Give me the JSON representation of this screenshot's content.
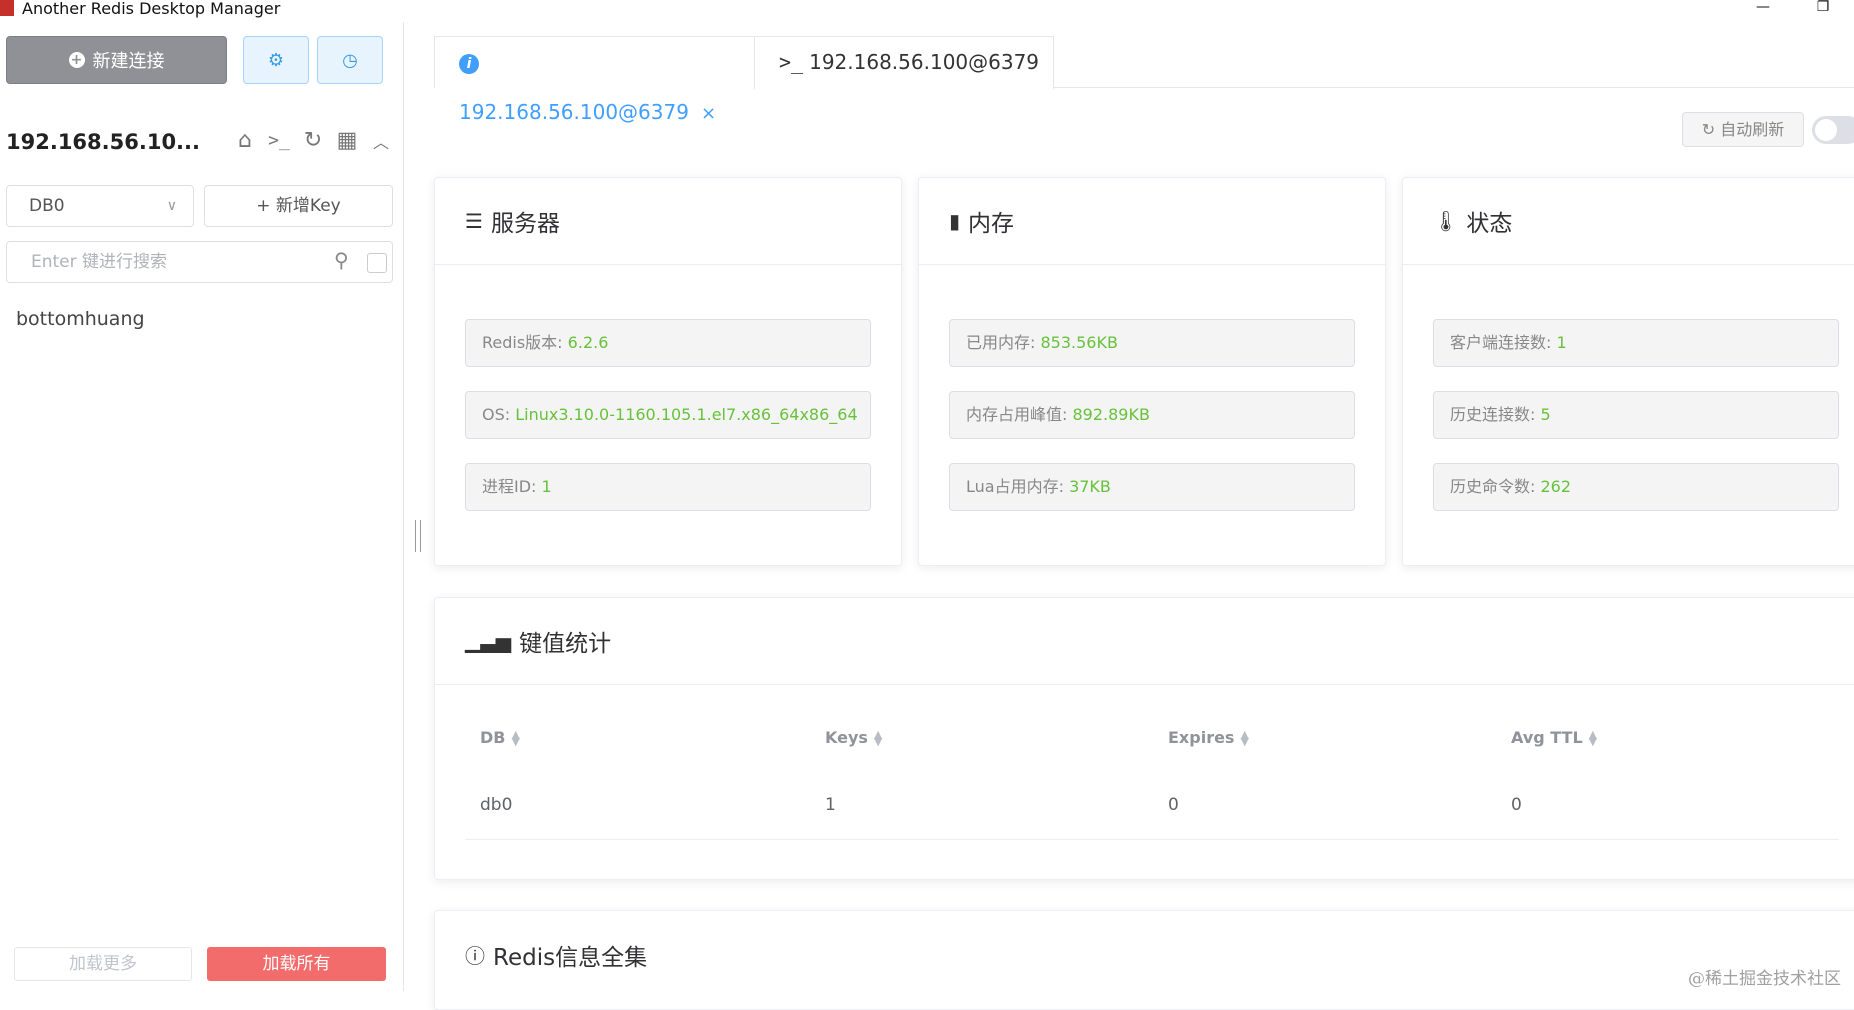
{
  "window": {
    "title": "Another Redis Desktop Manager",
    "minimize_glyph": "—",
    "restore_glyph": "❐"
  },
  "sidebar": {
    "new_connection_label": "新建连接",
    "connection_name": "192.168.56.10...",
    "db_selected": "DB0",
    "new_key_label": "+ 新增Key",
    "search_placeholder": "Enter 键进行搜索",
    "keys": [
      "bottomhuang"
    ],
    "load_more_label": "加载更多",
    "load_all_label": "加载所有"
  },
  "tabs": [
    {
      "label": "192.168.56.100@6379",
      "icon": "info-icon",
      "closable": true,
      "active": true
    },
    {
      "label": "192.168.56.100@6379",
      "icon": "terminal-icon",
      "prefix": ">_",
      "active": false
    }
  ],
  "toolbar": {
    "auto_refresh_label": "自动刷新",
    "auto_refresh_on": false
  },
  "cards": {
    "server": {
      "title": "服务器",
      "rows": [
        {
          "label": "Redis版本: ",
          "value": "6.2.6"
        },
        {
          "label": "OS: ",
          "value": "Linux3.10.0-1160.105.1.el7.x86_64x86_64"
        },
        {
          "label": "进程ID: ",
          "value": "1"
        }
      ]
    },
    "memory": {
      "title": "内存",
      "rows": [
        {
          "label": "已用内存: ",
          "value": "853.56KB"
        },
        {
          "label": "内存占用峰值: ",
          "value": "892.89KB"
        },
        {
          "label": "Lua占用内存: ",
          "value": "37KB"
        }
      ]
    },
    "status": {
      "title": "状态",
      "rows": [
        {
          "label": "客户端连接数: ",
          "value": "1"
        },
        {
          "label": "历史连接数: ",
          "value": "5"
        },
        {
          "label": "历史命令数: ",
          "value": "262"
        }
      ]
    }
  },
  "key_stats": {
    "title": "键值统计",
    "columns": [
      "DB",
      "Keys",
      "Expires",
      "Avg TTL"
    ],
    "rows": [
      [
        "db0",
        "1",
        "0",
        "0"
      ]
    ]
  },
  "redis_info": {
    "title": "Redis信息全集"
  },
  "watermark": "@稀土掘金技术社区",
  "colors": {
    "accent": "#409eff",
    "value_green": "#67c23a",
    "danger": "#f36c6c",
    "new_conn_bg": "#8f9196"
  }
}
